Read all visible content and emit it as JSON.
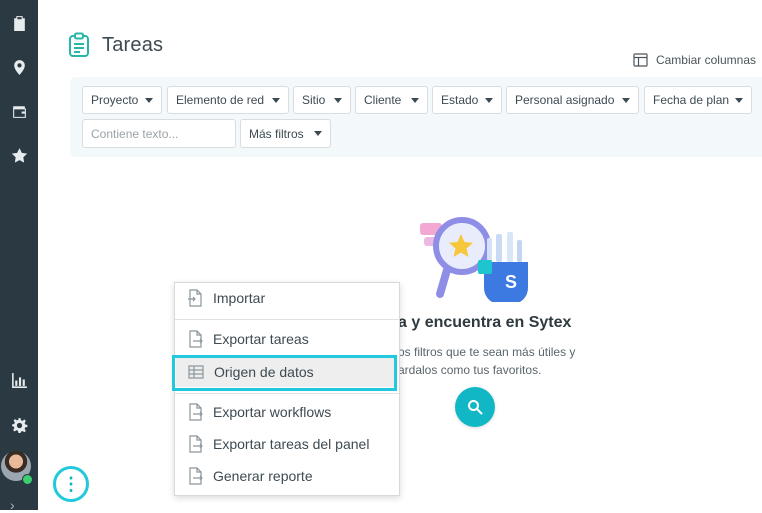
{
  "sidebar": {
    "icons": [
      "clipboard-icon",
      "location-pin-icon",
      "wallet-icon",
      "star-icon",
      "bar-chart-icon",
      "gear-icon"
    ]
  },
  "header": {
    "title": "Tareas",
    "change_columns": "Cambiar columnas"
  },
  "filters": [
    {
      "label": "Proyecto"
    },
    {
      "label": "Elemento de red"
    },
    {
      "label": "Sitio"
    },
    {
      "label": "Cliente"
    },
    {
      "label": "Estado"
    },
    {
      "label": "Personal asignado"
    },
    {
      "label": "Fecha de plan"
    }
  ],
  "search": {
    "placeholder": "Contiene texto..."
  },
  "more_filters": "Más filtros",
  "empty_state": {
    "heading": "a y encuentra en Sytex",
    "line1": "os filtros que te sean más útiles y",
    "line2": "ardalos como tus favoritos."
  },
  "menu": {
    "items": [
      {
        "label": "Importar"
      },
      {
        "label": "Exportar tareas"
      },
      {
        "label": "Origen de datos"
      },
      {
        "label": "Exportar workflows"
      },
      {
        "label": "Exportar tareas del panel"
      },
      {
        "label": "Generar reporte"
      }
    ]
  },
  "more_button": "⋮",
  "colors": {
    "sidebar": "#2b3942",
    "accent": "#12b7c6",
    "highlight": "#22c8dc"
  }
}
